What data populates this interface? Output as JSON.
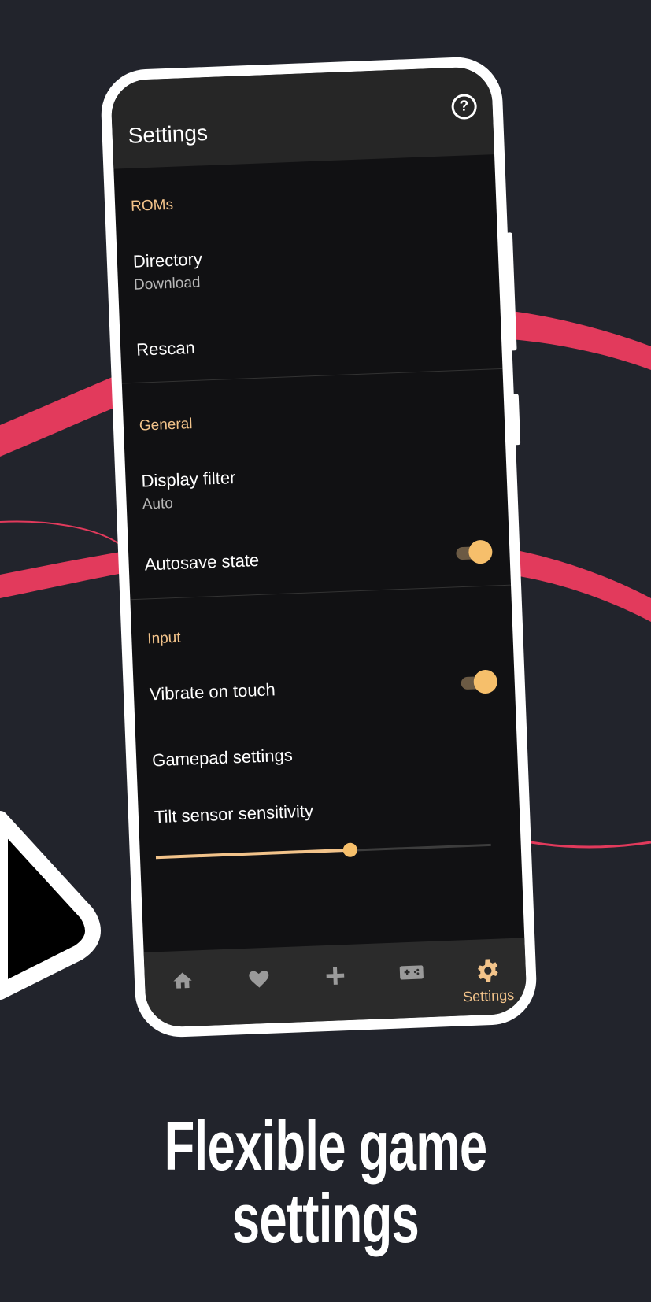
{
  "colors": {
    "background": "#22242c",
    "accent": "#f2c38a",
    "ribbon": "#e23a5c",
    "screen": "#111113",
    "appbar": "#262626",
    "nav": "#2b2b2b"
  },
  "appbar": {
    "title": "Settings",
    "help_icon": "help-circle-icon"
  },
  "sections": [
    {
      "header": "ROMs",
      "items": [
        {
          "title": "Directory",
          "subtitle": "Download"
        },
        {
          "title": "Rescan"
        }
      ]
    },
    {
      "header": "General",
      "items": [
        {
          "title": "Display filter",
          "subtitle": "Auto"
        },
        {
          "title": "Autosave state",
          "toggle": true
        }
      ]
    },
    {
      "header": "Input",
      "items": [
        {
          "title": "Vibrate on touch",
          "toggle": true
        },
        {
          "title": "Gamepad settings"
        },
        {
          "title": "Tilt sensor sensitivity",
          "slider_value_percent": 58
        }
      ]
    }
  ],
  "bottom_nav": [
    {
      "icon": "home-icon",
      "label": "",
      "active": false
    },
    {
      "icon": "heart-icon",
      "label": "",
      "active": false
    },
    {
      "icon": "plus-icon",
      "label": "",
      "active": false
    },
    {
      "icon": "gamepad-icon",
      "label": "",
      "active": false
    },
    {
      "icon": "gear-icon",
      "label": "Settings",
      "active": true
    }
  ],
  "tagline": {
    "line1": "Flexible game",
    "line2": "settings"
  }
}
